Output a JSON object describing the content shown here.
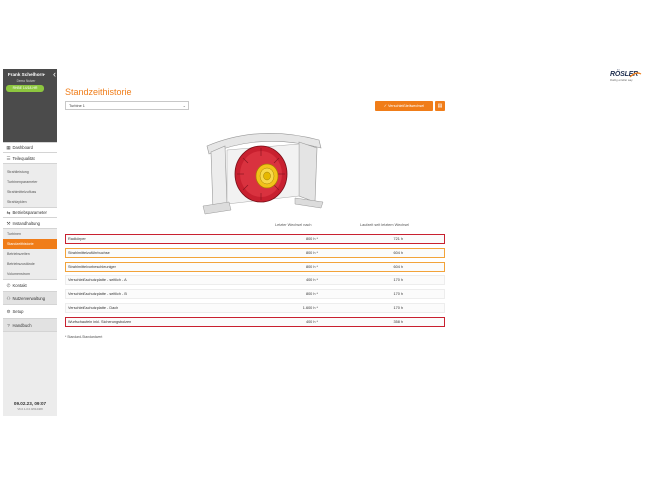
{
  "user": {
    "name": "Frank Schelhorn",
    "role": "Demo Nutzer",
    "mode": "RHBE 14/18-HR"
  },
  "nav": {
    "dashboard": "Dashboard",
    "teilequalitaet": "Teilequalität",
    "teilequalitaet_items": [
      "Strahlleistung",
      "Turbinenparameter",
      "Strahlmittelzufluss",
      "Strahlzyklen"
    ],
    "betriebsparameter": "Betriebsparameter",
    "instandhaltung": "Instandhaltung",
    "instandhaltung_items": [
      "Turbinen",
      "Standzeithistorie",
      "Betriebszeiten",
      "Betriebszustände",
      "Volumenstrom"
    ],
    "kontakt": "Kontakt",
    "nutzerverwaltung": "Nutzerverwaltung",
    "setup": "Setup",
    "handbuch": "Handbuch"
  },
  "footer": {
    "datetime": "09.02.23, 09:07",
    "version": "V6.0.1-0.0.0/012468"
  },
  "page": {
    "title": "Standzeithistorie",
    "select_value": "Turbine 1",
    "change_button": "Verschleißteilwechsel",
    "col_last_change": "Letzter Wechsel nach",
    "col_since_change": "Laufzeit seit letztem Wechsel",
    "footnote": "* Standard-Standardwert"
  },
  "logo": {
    "text": "RÖSLER",
    "tagline": "finding a better way"
  },
  "rows": [
    {
      "name": "Radkörper",
      "last": "800 h *",
      "since": "721 h",
      "status": "red"
    },
    {
      "name": "Strahlmittelzuführbuchse",
      "last": "800 h *",
      "since": "604 h",
      "status": "orange"
    },
    {
      "name": "Strahlmittelvorbeschleuniger",
      "last": "800 h *",
      "since": "604 h",
      "status": "orange"
    },
    {
      "name": "Verschleißschutzplatte - seitlich - A",
      "last": "400 h *",
      "since": "170 h",
      "status": "plain"
    },
    {
      "name": "Verschleißschutzplatte - seitlich - B",
      "last": "800 h *",
      "since": "170 h",
      "status": "plain"
    },
    {
      "name": "Verschleißschutzplatte - Dach",
      "last": "1.600 h *",
      "since": "170 h",
      "status": "plain"
    },
    {
      "name": "Wurfschaufeln inkl. Sicherungsbolzen",
      "last": "400 h *",
      "since": "358 h",
      "status": "red"
    }
  ],
  "colors": {
    "accent": "#f07d19",
    "alert": "#c8202f",
    "warn": "#f2a33a",
    "sidebar_top": "#4b4b4b",
    "mode_badge": "#8dc63f"
  },
  "icons": [
    "chevron-down-icon",
    "chevron-left-icon",
    "dashboard-icon",
    "quality-icon",
    "parameters-icon",
    "maintenance-icon",
    "contact-icon",
    "users-icon",
    "gear-icon",
    "help-icon",
    "check-icon",
    "calendar-icon"
  ]
}
